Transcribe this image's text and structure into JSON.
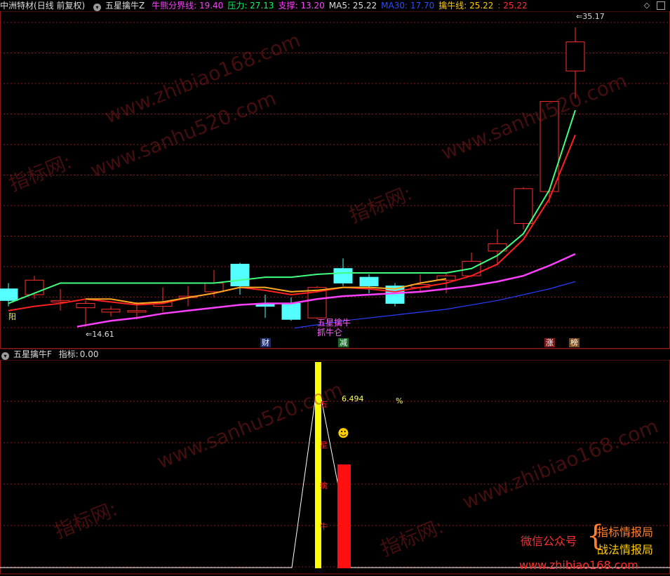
{
  "header": {
    "stock": "中洲特材",
    "mode": "(日线 前复权)",
    "indicator_name": "五星擒牛Z",
    "items": [
      {
        "label": "牛熊分界线:",
        "value": "19.40",
        "color": "#ff40ff"
      },
      {
        "label": "压力:",
        "value": "27.13",
        "color": "#00ff60"
      },
      {
        "label": "支撑:",
        "value": "13.20",
        "color": "#ff40ff"
      },
      {
        "label": "MA5:",
        "value": "25.22",
        "color": "#dddddd"
      },
      {
        "label": "MA30:",
        "value": "17.70",
        "color": "#2a4dff"
      },
      {
        "label": "擒牛线:",
        "value": "25.22",
        "color": "#ffcc00"
      },
      {
        "label": ":",
        "value": "25.22",
        "color": "#ff3030"
      }
    ]
  },
  "main_chart": {
    "high_label": "35.17",
    "low_label": "14.61",
    "left_badge": "阳",
    "signal_line1": "五星擒牛",
    "signal_line2": "抓牛仑",
    "bottom_badges": [
      "财",
      "减",
      "涨",
      "榜"
    ]
  },
  "sub_header": {
    "indicator_name": "五星擒牛F",
    "label": "指标:",
    "value": "0.00"
  },
  "sub_chart": {
    "pct_value": "6.494",
    "pct_sign": "%",
    "smiley": "☻",
    "vertical_chars": [
      "五",
      "星",
      "擒",
      "牛"
    ]
  },
  "watermarks": {
    "site1": "www.zhibiao168.com",
    "site2": "www.sanhu520.com",
    "brand": "指标网:",
    "promo_label": "微信公众号",
    "promo_line1": "指标情报局",
    "promo_line2": "战法情报局",
    "promo_url": "www.zhibiao168.com"
  },
  "colors": {
    "up": "#ff3030",
    "down": "#54ffff",
    "grid": "#8b1a1a",
    "ma_red": "#ff2020",
    "ma_green": "#40ff80",
    "support": "#ff40ff",
    "ma30": "#2a3dff"
  }
}
